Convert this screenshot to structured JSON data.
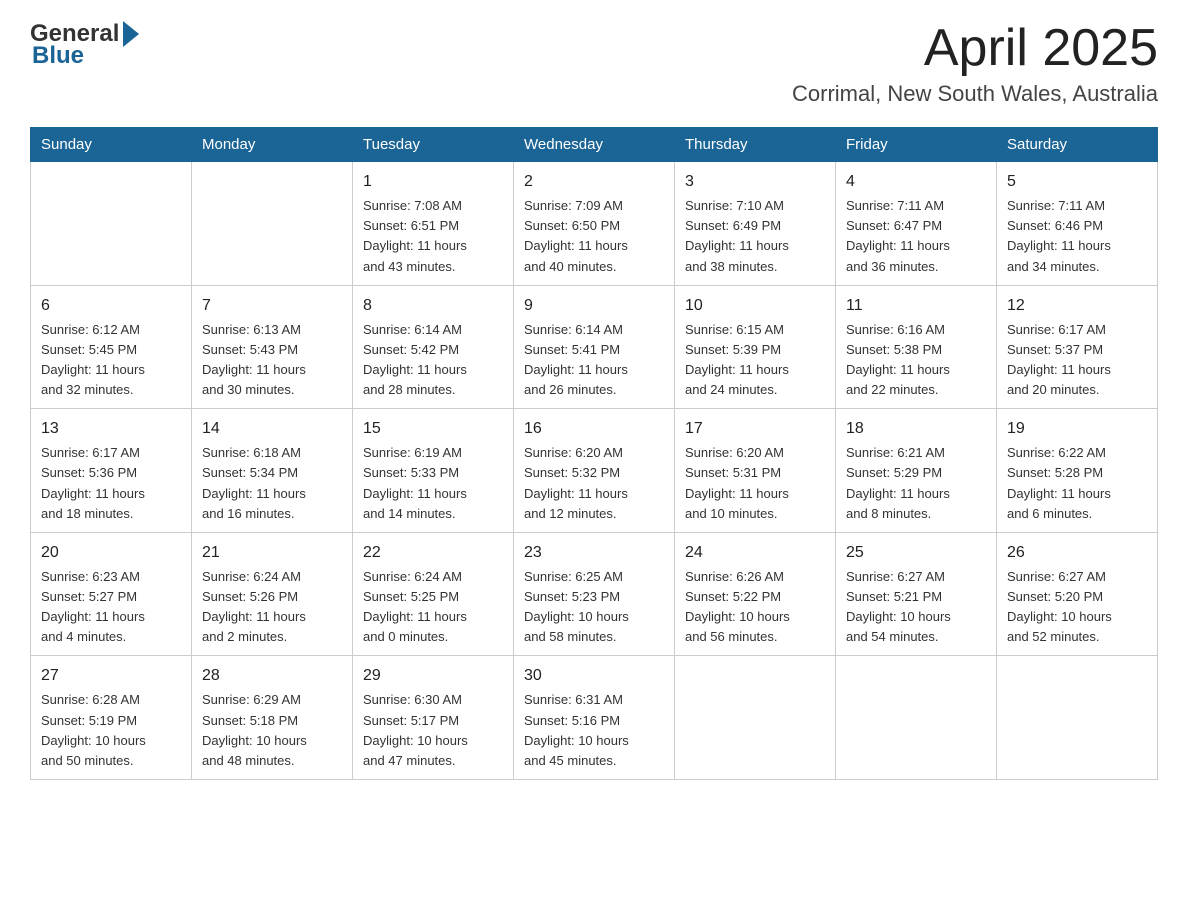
{
  "header": {
    "logo_general": "General",
    "logo_blue": "Blue",
    "month_title": "April 2025",
    "location": "Corrimal, New South Wales, Australia"
  },
  "weekdays": [
    "Sunday",
    "Monday",
    "Tuesday",
    "Wednesday",
    "Thursday",
    "Friday",
    "Saturday"
  ],
  "weeks": [
    [
      {
        "day": "",
        "info": ""
      },
      {
        "day": "",
        "info": ""
      },
      {
        "day": "1",
        "info": "Sunrise: 7:08 AM\nSunset: 6:51 PM\nDaylight: 11 hours\nand 43 minutes."
      },
      {
        "day": "2",
        "info": "Sunrise: 7:09 AM\nSunset: 6:50 PM\nDaylight: 11 hours\nand 40 minutes."
      },
      {
        "day": "3",
        "info": "Sunrise: 7:10 AM\nSunset: 6:49 PM\nDaylight: 11 hours\nand 38 minutes."
      },
      {
        "day": "4",
        "info": "Sunrise: 7:11 AM\nSunset: 6:47 PM\nDaylight: 11 hours\nand 36 minutes."
      },
      {
        "day": "5",
        "info": "Sunrise: 7:11 AM\nSunset: 6:46 PM\nDaylight: 11 hours\nand 34 minutes."
      }
    ],
    [
      {
        "day": "6",
        "info": "Sunrise: 6:12 AM\nSunset: 5:45 PM\nDaylight: 11 hours\nand 32 minutes."
      },
      {
        "day": "7",
        "info": "Sunrise: 6:13 AM\nSunset: 5:43 PM\nDaylight: 11 hours\nand 30 minutes."
      },
      {
        "day": "8",
        "info": "Sunrise: 6:14 AM\nSunset: 5:42 PM\nDaylight: 11 hours\nand 28 minutes."
      },
      {
        "day": "9",
        "info": "Sunrise: 6:14 AM\nSunset: 5:41 PM\nDaylight: 11 hours\nand 26 minutes."
      },
      {
        "day": "10",
        "info": "Sunrise: 6:15 AM\nSunset: 5:39 PM\nDaylight: 11 hours\nand 24 minutes."
      },
      {
        "day": "11",
        "info": "Sunrise: 6:16 AM\nSunset: 5:38 PM\nDaylight: 11 hours\nand 22 minutes."
      },
      {
        "day": "12",
        "info": "Sunrise: 6:17 AM\nSunset: 5:37 PM\nDaylight: 11 hours\nand 20 minutes."
      }
    ],
    [
      {
        "day": "13",
        "info": "Sunrise: 6:17 AM\nSunset: 5:36 PM\nDaylight: 11 hours\nand 18 minutes."
      },
      {
        "day": "14",
        "info": "Sunrise: 6:18 AM\nSunset: 5:34 PM\nDaylight: 11 hours\nand 16 minutes."
      },
      {
        "day": "15",
        "info": "Sunrise: 6:19 AM\nSunset: 5:33 PM\nDaylight: 11 hours\nand 14 minutes."
      },
      {
        "day": "16",
        "info": "Sunrise: 6:20 AM\nSunset: 5:32 PM\nDaylight: 11 hours\nand 12 minutes."
      },
      {
        "day": "17",
        "info": "Sunrise: 6:20 AM\nSunset: 5:31 PM\nDaylight: 11 hours\nand 10 minutes."
      },
      {
        "day": "18",
        "info": "Sunrise: 6:21 AM\nSunset: 5:29 PM\nDaylight: 11 hours\nand 8 minutes."
      },
      {
        "day": "19",
        "info": "Sunrise: 6:22 AM\nSunset: 5:28 PM\nDaylight: 11 hours\nand 6 minutes."
      }
    ],
    [
      {
        "day": "20",
        "info": "Sunrise: 6:23 AM\nSunset: 5:27 PM\nDaylight: 11 hours\nand 4 minutes."
      },
      {
        "day": "21",
        "info": "Sunrise: 6:24 AM\nSunset: 5:26 PM\nDaylight: 11 hours\nand 2 minutes."
      },
      {
        "day": "22",
        "info": "Sunrise: 6:24 AM\nSunset: 5:25 PM\nDaylight: 11 hours\nand 0 minutes."
      },
      {
        "day": "23",
        "info": "Sunrise: 6:25 AM\nSunset: 5:23 PM\nDaylight: 10 hours\nand 58 minutes."
      },
      {
        "day": "24",
        "info": "Sunrise: 6:26 AM\nSunset: 5:22 PM\nDaylight: 10 hours\nand 56 minutes."
      },
      {
        "day": "25",
        "info": "Sunrise: 6:27 AM\nSunset: 5:21 PM\nDaylight: 10 hours\nand 54 minutes."
      },
      {
        "day": "26",
        "info": "Sunrise: 6:27 AM\nSunset: 5:20 PM\nDaylight: 10 hours\nand 52 minutes."
      }
    ],
    [
      {
        "day": "27",
        "info": "Sunrise: 6:28 AM\nSunset: 5:19 PM\nDaylight: 10 hours\nand 50 minutes."
      },
      {
        "day": "28",
        "info": "Sunrise: 6:29 AM\nSunset: 5:18 PM\nDaylight: 10 hours\nand 48 minutes."
      },
      {
        "day": "29",
        "info": "Sunrise: 6:30 AM\nSunset: 5:17 PM\nDaylight: 10 hours\nand 47 minutes."
      },
      {
        "day": "30",
        "info": "Sunrise: 6:31 AM\nSunset: 5:16 PM\nDaylight: 10 hours\nand 45 minutes."
      },
      {
        "day": "",
        "info": ""
      },
      {
        "day": "",
        "info": ""
      },
      {
        "day": "",
        "info": ""
      }
    ]
  ]
}
